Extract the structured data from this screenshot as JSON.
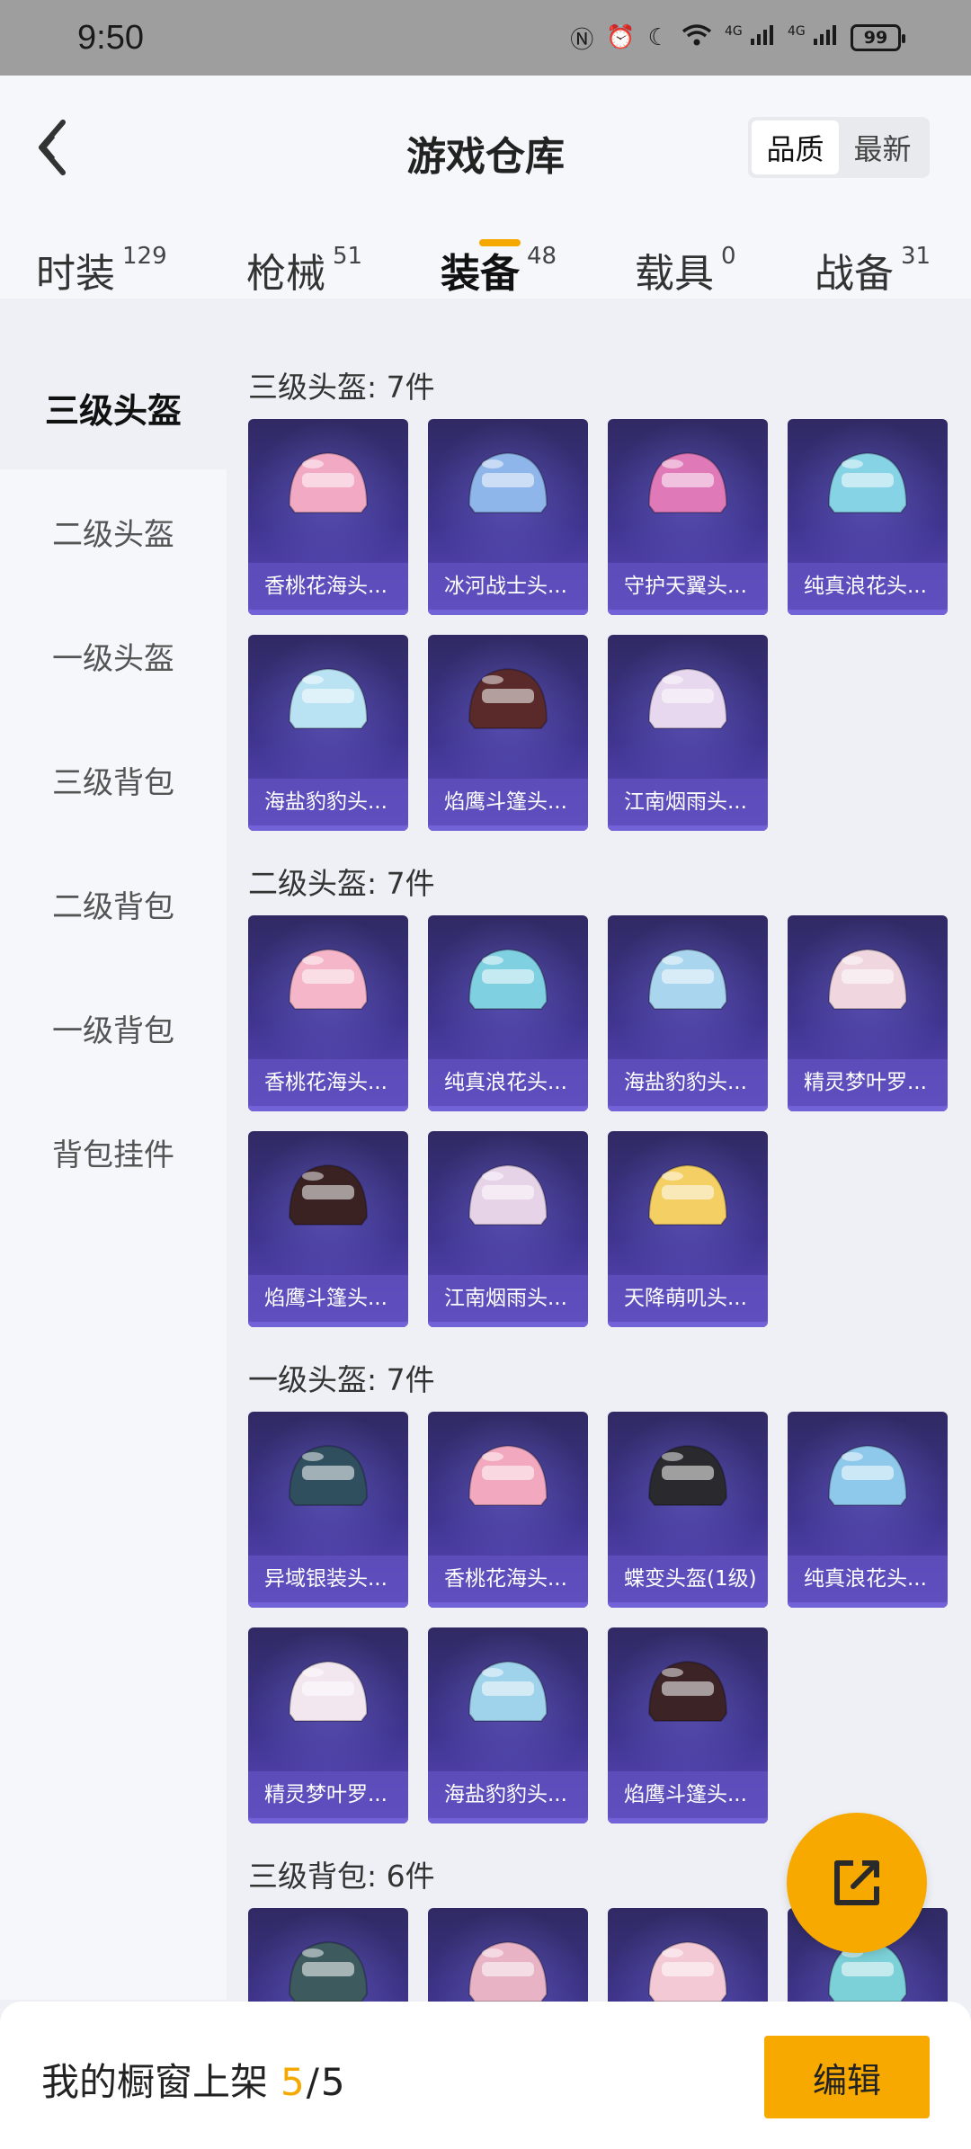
{
  "status_bar": {
    "time": "9:50",
    "battery": "99",
    "signal1": "4G",
    "signal2": "4G"
  },
  "header": {
    "title": "游戏仓库",
    "sort_options": [
      "品质",
      "最新"
    ],
    "sort_selected": "品质"
  },
  "tabs": [
    {
      "label": "时装",
      "count": "129"
    },
    {
      "label": "枪械",
      "count": "51"
    },
    {
      "label": "装备",
      "count": "48",
      "active": true
    },
    {
      "label": "载具",
      "count": "0"
    },
    {
      "label": "战备",
      "count": "31"
    }
  ],
  "sidebar": {
    "items": [
      "三级头盔",
      "二级头盔",
      "一级头盔",
      "三级背包",
      "二级背包",
      "一级背包",
      "背包挂件"
    ],
    "active": "三级头盔"
  },
  "sections": [
    {
      "title": "三级头盔: 7件",
      "items": [
        {
          "name": "香桃花海头...",
          "color": "#f2a9c4"
        },
        {
          "name": "冰河战士头...",
          "color": "#8fb6ea"
        },
        {
          "name": "守护天翼头...",
          "color": "#e079b8"
        },
        {
          "name": "纯真浪花头...",
          "color": "#86d3e6"
        },
        {
          "name": "海盐豹豹头...",
          "color": "#b9e3f2"
        },
        {
          "name": "焰鹰斗篷头...",
          "color": "#5a2a2a"
        },
        {
          "name": "江南烟雨头...",
          "color": "#e7d8ef"
        }
      ]
    },
    {
      "title": "二级头盔: 7件",
      "items": [
        {
          "name": "香桃花海头...",
          "color": "#f4b6c8"
        },
        {
          "name": "纯真浪花头...",
          "color": "#7fd0e0"
        },
        {
          "name": "海盐豹豹头...",
          "color": "#a9d6ee"
        },
        {
          "name": "精灵梦叶罗...",
          "color": "#f0d7df"
        },
        {
          "name": "焰鹰斗篷头...",
          "color": "#3a2222"
        },
        {
          "name": "江南烟雨头...",
          "color": "#e6d3e8"
        },
        {
          "name": "天降萌叽头...",
          "color": "#f4cf63"
        }
      ]
    },
    {
      "title": "一级头盔: 7件",
      "items": [
        {
          "name": "异域银装头...",
          "color": "#2f4f5e"
        },
        {
          "name": "香桃花海头...",
          "color": "#f2a9bf"
        },
        {
          "name": "蝶变头盔(1级)",
          "color": "#2a2a2e"
        },
        {
          "name": "纯真浪花头...",
          "color": "#8ec9ec"
        },
        {
          "name": "精灵梦叶罗...",
          "color": "#f2e7ee"
        },
        {
          "name": "海盐豹豹头...",
          "color": "#9fd3ec"
        },
        {
          "name": "焰鹰斗篷头...",
          "color": "#3b2326"
        }
      ]
    },
    {
      "title": "三级背包: 6件",
      "items": [
        {
          "name": "",
          "color": "#3d5a5e"
        },
        {
          "name": "",
          "color": "#e9b3c6"
        },
        {
          "name": "",
          "color": "#f3c9d6"
        },
        {
          "name": "",
          "color": "#7cd1d8"
        }
      ]
    }
  ],
  "bottom_bar": {
    "label": "我的橱窗上架",
    "current": "5",
    "separator": "/",
    "total": "5",
    "edit_label": "编辑"
  }
}
